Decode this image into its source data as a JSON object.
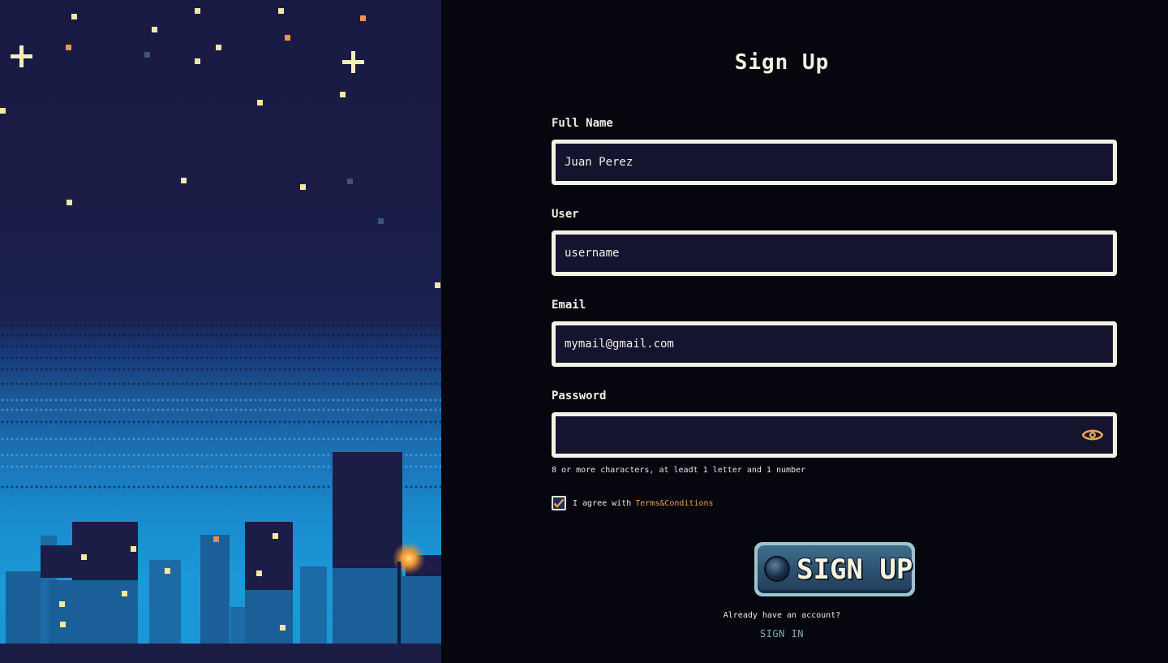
{
  "form": {
    "title": "Sign Up",
    "full_name": {
      "label": "Full Name",
      "value": "Juan Perez",
      "placeholder": ""
    },
    "user": {
      "label": "User",
      "value": "",
      "placeholder": "username"
    },
    "email": {
      "label": "Email",
      "value": "",
      "placeholder": "mymail@gmail.com"
    },
    "password": {
      "label": "Password",
      "value": "",
      "placeholder": "",
      "toggle_icon": "eye-icon",
      "hint": "8 or more characters, at leadt 1 letter and 1 number"
    },
    "agree": {
      "checked": true,
      "text": "I agree with",
      "link": "Terms&Conditions"
    },
    "submit_label": "SIGN UP",
    "already_text": "Already have an account?",
    "signin_label": "SIGN IN"
  },
  "colors": {
    "accent_orange": "#e9a44f",
    "field_border": "#f4f2e6",
    "field_bg": "#14142e",
    "signin_link": "#7fa8b8",
    "page_bg": "#06060f"
  }
}
